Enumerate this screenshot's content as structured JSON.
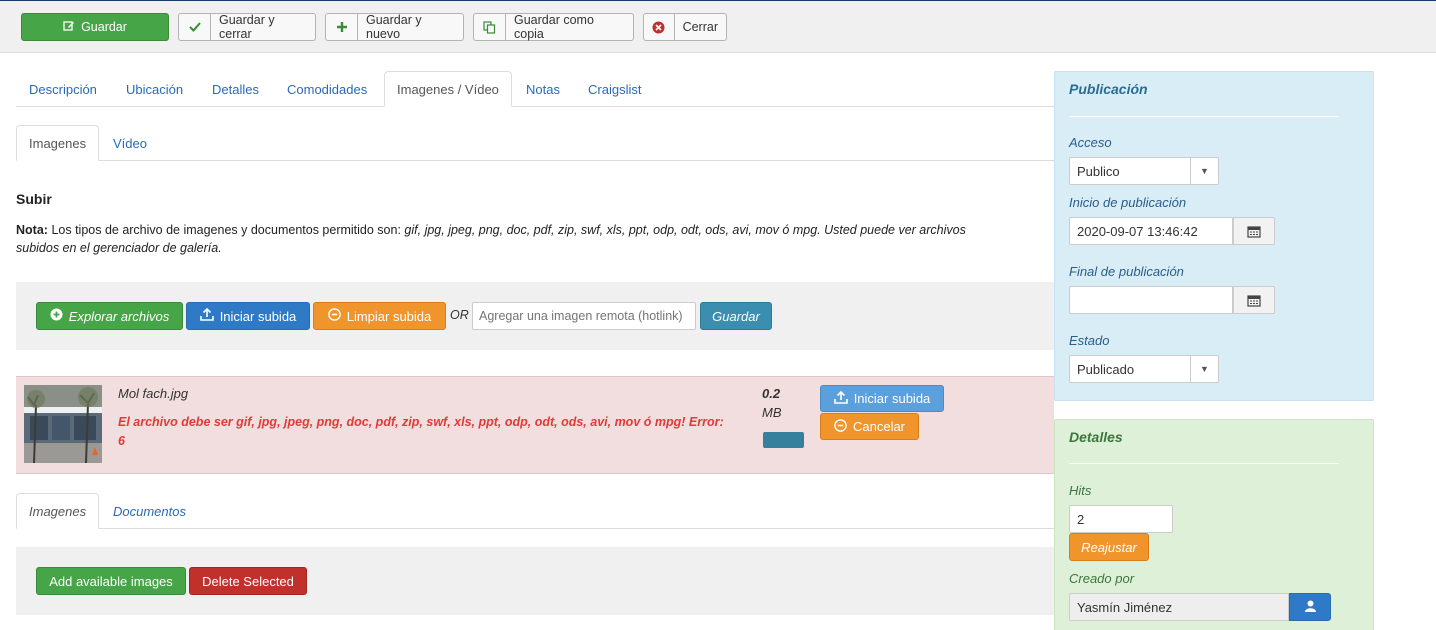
{
  "toolbar": {
    "save": "Guardar",
    "save_close": "Guardar y cerrar",
    "save_new": "Guardar y nuevo",
    "save_copy": "Guardar como copia",
    "close": "Cerrar"
  },
  "main_tabs": [
    "Descripción",
    "Ubicación",
    "Detalles",
    "Comodidades",
    "Imagenes / Vídeo",
    "Notas",
    "Craigslist"
  ],
  "sub_tabs": [
    "Imagenes",
    "Vídeo"
  ],
  "upload": {
    "heading": "Subir",
    "note_label": "Nota:",
    "note_text": "Los tipos de archivo de imagenes y documentos permitido son:",
    "note_types": "gif, jpg, jpeg, png, doc, pdf, zip, swf, xls, ppt, odp, odt, ods, avi, mov ó mpg. Usted puede ver archivos",
    "note_types2": "subidos en el gerenciador de galería.",
    "browse": "Explorar archivos",
    "start": "Iniciar subida",
    "clear": "Limpiar subida",
    "or": "OR",
    "remote_placeholder": "Agregar una imagen remota (hotlink)",
    "save": "Guardar"
  },
  "file": {
    "name": "Mol fach.jpg",
    "error": "El archivo debe ser gif, jpg, jpeg, png, doc, pdf, zip, swf, xls, ppt, odp, odt, ods, avi, mov ó mpg! Error:",
    "error_code": "6",
    "size_value": "0.2",
    "size_unit": "MB",
    "start": "Iniciar subida",
    "cancel": "Cancelar"
  },
  "bottom_tabs": [
    "Imagenes",
    "Documentos"
  ],
  "bottom_actions": {
    "add": "Add available images",
    "delete": "Delete Selected"
  },
  "publication": {
    "title": "Publicación",
    "access_label": "Acceso",
    "access_value": "Publico",
    "start_label": "Inicio de publicación",
    "start_value": "2020-09-07 13:46:42",
    "end_label": "Final de publicación",
    "end_value": "",
    "state_label": "Estado",
    "state_value": "Publicado"
  },
  "details": {
    "title": "Detalles",
    "hits_label": "Hits",
    "hits_value": "2",
    "reset": "Reajustar",
    "created_by_label": "Creado por",
    "created_by_value": "Yasmín Jiménez"
  },
  "colors": {
    "green": "#46a546",
    "blue": "#2f7ac7",
    "orange": "#f0942c",
    "red": "#c0312c",
    "error_text": "#e03a3a",
    "pub_panel": "#d9edf7",
    "details_panel": "#dff0d8"
  }
}
